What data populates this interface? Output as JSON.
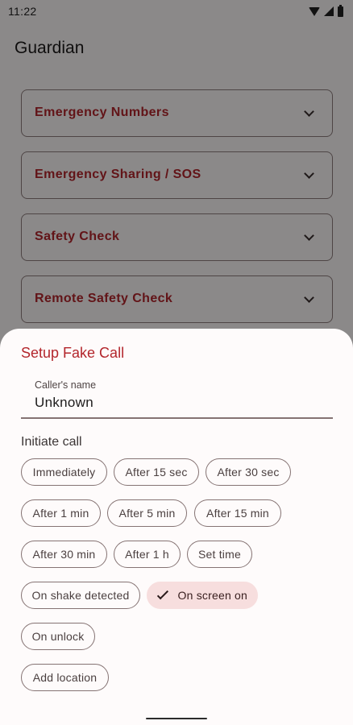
{
  "status": {
    "time": "11:22"
  },
  "app": {
    "title": "Guardian",
    "sections": [
      {
        "label": "Emergency Numbers"
      },
      {
        "label": "Emergency Sharing / SOS"
      },
      {
        "label": "Safety Check"
      },
      {
        "label": "Remote Safety Check"
      }
    ]
  },
  "sheet": {
    "title": "Setup Fake Call",
    "caller_label": "Caller's name",
    "caller_value": "Unknown",
    "initiate_label": "Initiate call",
    "chips": [
      {
        "label": "Immediately",
        "selected": false
      },
      {
        "label": "After 15 sec",
        "selected": false
      },
      {
        "label": "After 30 sec",
        "selected": false
      },
      {
        "label": "After 1 min",
        "selected": false
      },
      {
        "label": "After 5 min",
        "selected": false
      },
      {
        "label": "After 15 min",
        "selected": false
      },
      {
        "label": "After 30 min",
        "selected": false
      },
      {
        "label": "After 1 h",
        "selected": false
      },
      {
        "label": "Set time",
        "selected": false
      },
      {
        "label": "On shake detected",
        "selected": false
      },
      {
        "label": "On screen on",
        "selected": true
      },
      {
        "label": "On unlock",
        "selected": false
      },
      {
        "label": "Add location",
        "selected": false
      }
    ]
  },
  "colors": {
    "accent": "#b3262c",
    "selected_chip": "#f7dede"
  }
}
